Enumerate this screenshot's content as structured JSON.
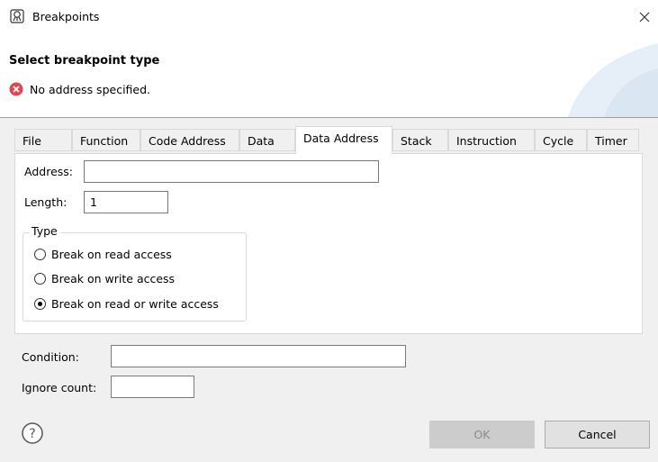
{
  "window": {
    "title": "Breakpoints",
    "icon": "breakpoint-icon"
  },
  "header": {
    "title": "Select breakpoint type",
    "error_message": "No address specified.",
    "error_icon": "error-icon"
  },
  "tabs": [
    {
      "label": "File",
      "active": false
    },
    {
      "label": "Function",
      "active": false
    },
    {
      "label": "Code Address",
      "active": false
    },
    {
      "label": "Data",
      "active": false
    },
    {
      "label": "Data Address",
      "active": true
    },
    {
      "label": "Stack",
      "active": false
    },
    {
      "label": "Instruction",
      "active": false
    },
    {
      "label": "Cycle",
      "active": false
    },
    {
      "label": "Timer",
      "active": false
    }
  ],
  "panel": {
    "address_label": "Address:",
    "address_value": "",
    "length_label": "Length:",
    "length_value": "1",
    "type_group_label": "Type",
    "type_options": [
      {
        "label": "Break on read access",
        "selected": false
      },
      {
        "label": "Break on write access",
        "selected": false
      },
      {
        "label": "Break on read or write access",
        "selected": true
      }
    ]
  },
  "condition": {
    "label": "Condition:",
    "value": ""
  },
  "ignore_count": {
    "label": "Ignore count:",
    "value": ""
  },
  "buttons": {
    "ok": "OK",
    "cancel": "Cancel",
    "ok_enabled": false
  },
  "colors": {
    "error_red": "#e0464e",
    "ok_disabled_bg": "#cccccc",
    "banner_blue": "#dbe6f3"
  }
}
